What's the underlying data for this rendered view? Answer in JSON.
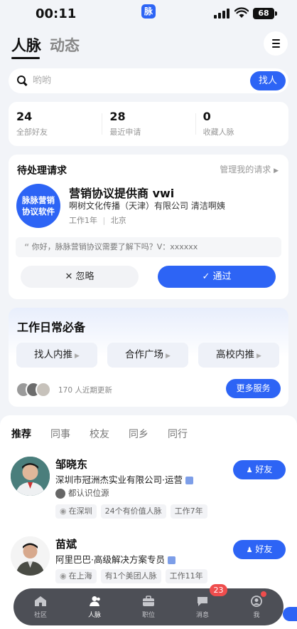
{
  "status_bar": {
    "time": "00:11",
    "app_badge": "脉",
    "battery": "68"
  },
  "header": {
    "tab_active": "人脉",
    "tab_inactive": "动态"
  },
  "search": {
    "placeholder": "哟哟",
    "button": "找人"
  },
  "stats": [
    {
      "num": "24",
      "label": "全部好友"
    },
    {
      "num": "28",
      "label": "最近申请"
    },
    {
      "num": "0",
      "label": "收藏人脉"
    }
  ],
  "pending": {
    "title": "待处理请求",
    "manage": "管理我的请求",
    "avatar_line1": "脉脉营销",
    "avatar_line2": "协议软件",
    "name": "营销协议提供商 vwi",
    "company": "啊树文化传播（天津）有限公司 清洁啊姨",
    "meta_years": "工作1年",
    "meta_city": "北京",
    "message": "你好，脉脉营销协议需要了解下吗？V：xxxxxx",
    "ignore": "忽略",
    "accept": "通过"
  },
  "daily": {
    "title": "工作日常必备",
    "chips": [
      "找人内推",
      "合作广场",
      "高校内推"
    ],
    "update_text": "170 人近期更新",
    "more": "更多服务"
  },
  "feed": {
    "tabs": [
      "推荐",
      "同事",
      "校友",
      "同乡",
      "同行"
    ],
    "people": [
      {
        "name": "邹晓东",
        "title": "深圳市冠洲杰实业有限公司·运营",
        "source": "都认识位源",
        "tags": [
          "在深圳",
          "24个有价值人脉",
          "工作7年"
        ],
        "button": "好友"
      },
      {
        "name": "苗斌",
        "title": "阿里巴巴·高级解决方案专员",
        "tags": [
          "在上海",
          "有1个美团人脉",
          "工作11年"
        ],
        "button": "好友"
      }
    ]
  },
  "bottom_nav": {
    "items": [
      {
        "label": "社区",
        "icon": "home-icon"
      },
      {
        "label": "人脉",
        "icon": "contacts-icon"
      },
      {
        "label": "职位",
        "icon": "briefcase-icon"
      },
      {
        "label": "消息",
        "icon": "message-icon",
        "badge": "23"
      },
      {
        "label": "我",
        "icon": "profile-icon"
      }
    ]
  },
  "colors": {
    "accent": "#2d64f5",
    "badge": "#ef4d4d",
    "nav_bg": "#4d4f56"
  }
}
